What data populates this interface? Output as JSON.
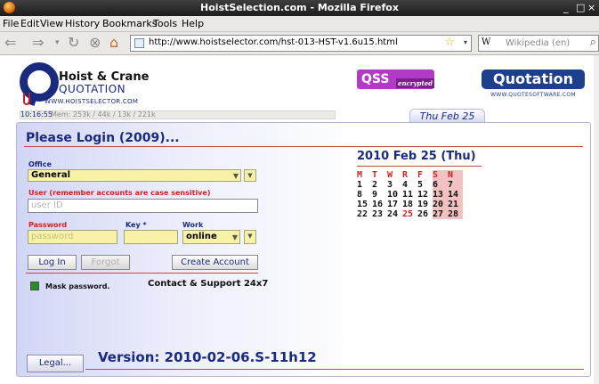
{
  "window": {
    "title": "HoistSelection.com - Mozilla Firefox",
    "controls": [
      "_",
      "□",
      "×"
    ]
  },
  "menu": [
    "File",
    "Edit",
    "View",
    "History",
    "Bookmarks",
    "Tools",
    "Help"
  ],
  "nav": {
    "url": "http://www.hoistselector.com/hst-013-HST-v1.6u15.html",
    "search_engine": "W",
    "search_placeholder": "Wikipedia (en)"
  },
  "header": {
    "logo_line1": "Hoist & Crane",
    "logo_line2": "QUOTATION",
    "logo_url": "WWW.HOISTSELECTOR.COM",
    "qss_label": "QSS",
    "qss_encrypted": "encrypted",
    "quote_logo": "Quotation",
    "quote_url": "WWW.QUOTESOFTWARE.COM",
    "clock": "10:16:55",
    "memory": "Mem: 253k / 44k / 13k / 221k",
    "date_tab": "Thu Feb 25"
  },
  "login": {
    "title": "Please Login (2009)...",
    "office_label": "Office",
    "office_value": "General",
    "user_label": "User (remember accounts are case sensitive)",
    "user_placeholder": "user ID",
    "password_label": "Password",
    "password_placeholder": "password",
    "key_label": "Key *",
    "work_label": "Work",
    "work_value": "online",
    "login_button": "Log In",
    "forgot_button": "Forgot",
    "create_button": "Create Account",
    "mask_label": "Mask password.",
    "support": "Contact & Support  24x7",
    "version": "Version: 2010-02-06.S-11h12",
    "legal_button": "Legal..."
  },
  "calendar": {
    "title": "2010 Feb 25 (Thu)",
    "headers": [
      "M",
      "T",
      "W",
      "R",
      "F",
      "S",
      "N"
    ],
    "weeks": [
      [
        "1",
        "2",
        "3",
        "4",
        "5",
        "6",
        "7"
      ],
      [
        "8",
        "9",
        "10",
        "11",
        "12",
        "13",
        "14"
      ],
      [
        "15",
        "16",
        "17",
        "18",
        "19",
        "20",
        "21"
      ],
      [
        "22",
        "23",
        "24",
        "25",
        "26",
        "27",
        "28"
      ]
    ],
    "today": "25"
  },
  "colors": {
    "brand_blue": "#1a2b7e",
    "accent_red": "#d42020",
    "field_yellow": "#f7f2a6",
    "weekend_pink": "#f2c2c2",
    "qss_purple": "#b13bc4"
  }
}
